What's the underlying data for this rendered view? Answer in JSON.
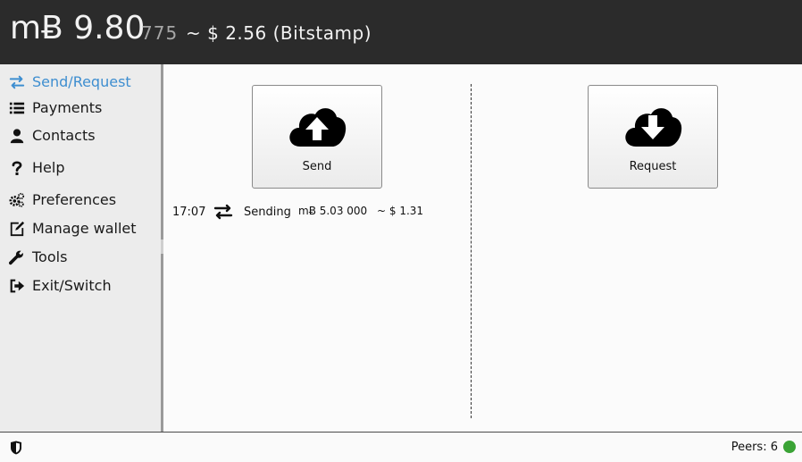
{
  "header": {
    "balance_main": "mɃ 9.80",
    "balance_small": "775",
    "balance_fiat": "~ $ 2.56 (Bitstamp)"
  },
  "sidebar": {
    "items": [
      {
        "label": "Send/Request",
        "icon": "transfer-arrows-icon",
        "active": true
      },
      {
        "label": "Payments",
        "icon": "list-icon"
      },
      {
        "label": "Contacts",
        "icon": "user-icon"
      },
      {
        "label": "Help",
        "icon": "question-icon"
      },
      {
        "label": "Preferences",
        "icon": "gears-icon"
      },
      {
        "label": "Manage wallet",
        "icon": "edit-icon"
      },
      {
        "label": "Tools",
        "icon": "wrench-icon"
      },
      {
        "label": "Exit/Switch",
        "icon": "sign-out-icon"
      }
    ]
  },
  "main": {
    "send_label": "Send",
    "request_label": "Request",
    "transactions": [
      {
        "time": "17:07",
        "status": "Sending",
        "amount": "mɃ 5.03 000",
        "fiat": "~ $ 1.31"
      }
    ]
  },
  "footer": {
    "peers": "Peers: 6",
    "peers_status_color": "#3aa335"
  },
  "colors": {
    "accent": "#3e8ed0",
    "header_bg": "#2b2b2b"
  }
}
